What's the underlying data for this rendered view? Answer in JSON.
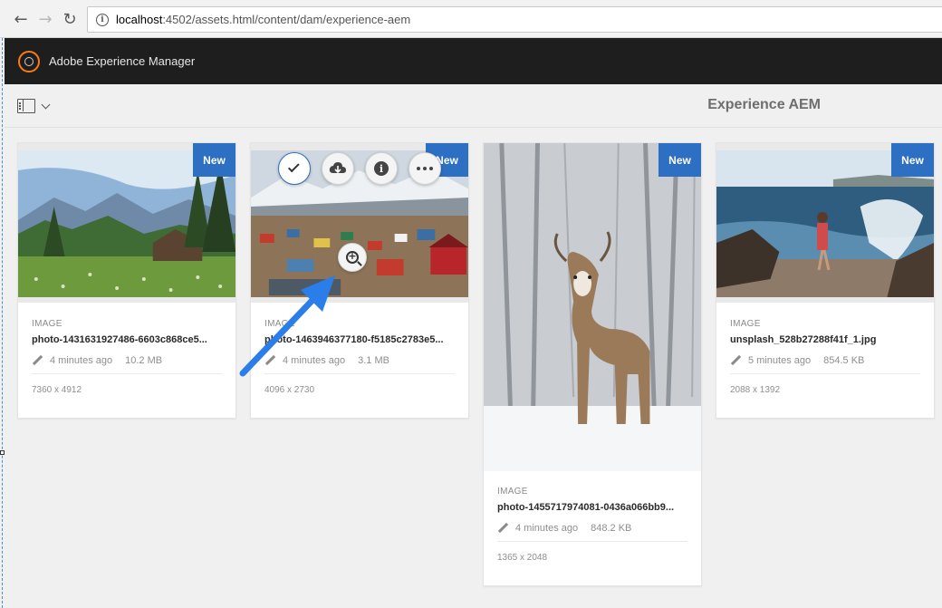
{
  "browser": {
    "url_host": "localhost",
    "url_path": ":4502/assets.html/content/dam/experience-aem"
  },
  "header": {
    "title": "Adobe Experience Manager"
  },
  "toolbar": {
    "title": "Experience AEM"
  },
  "cards": [
    {
      "badge": "New",
      "type": "IMAGE",
      "name": "photo-1431631927486-6603c868ce5...",
      "time": "4 minutes ago",
      "size": "10.2 MB",
      "dims": "7360 x 4912"
    },
    {
      "badge": "New",
      "type": "IMAGE",
      "name": "photo-1463946377180-f5185c2783e5...",
      "time": "4 minutes ago",
      "size": "3.1 MB",
      "dims": "4096 x 2730"
    },
    {
      "badge": "New",
      "type": "IMAGE",
      "name": "photo-1455717974081-0436a066bb9...",
      "time": "4 minutes ago",
      "size": "848.2 KB",
      "dims": "1365 x 2048"
    },
    {
      "badge": "New",
      "type": "IMAGE",
      "name": "unsplash_528b27288f41f_1.jpg",
      "time": "5 minutes ago",
      "size": "854.5 KB",
      "dims": "2088 x 1392"
    }
  ],
  "colors": {
    "accent": "#2d6fc2",
    "header_bg": "#1e1e1e",
    "logo": "#fa7b17",
    "annotation_arrow": "#2b7de9"
  },
  "icons": {
    "quick_actions": [
      "check-icon",
      "download-icon",
      "info-icon",
      "more-icon"
    ],
    "preview": "zoom-in-icon"
  }
}
